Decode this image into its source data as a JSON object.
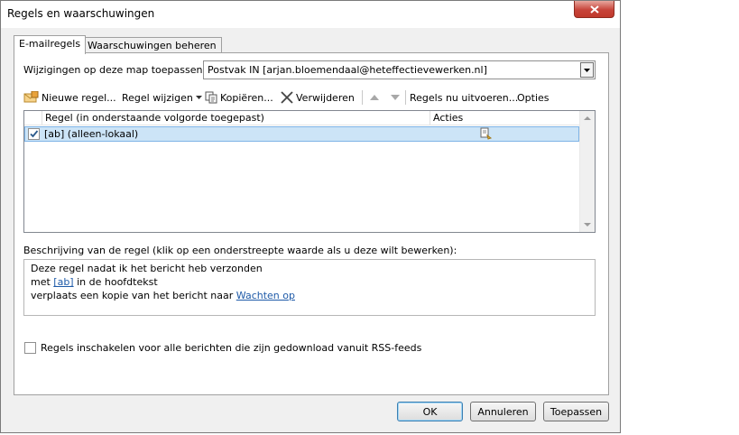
{
  "window": {
    "title": "Regels en waarschuwingen"
  },
  "tabs": [
    {
      "label": "E-mailregels",
      "active": true
    },
    {
      "label": "Waarschuwingen beheren",
      "active": false
    }
  ],
  "folder": {
    "label": "Wijzigingen op deze map toepassen:",
    "value": "Postvak IN [arjan.bloemendaal@heteffectievewerken.nl]"
  },
  "toolbar": {
    "new_rule": "Nieuwe regel...",
    "change_rule": "Regel wijzigen",
    "copy": "Kopiëren...",
    "delete": "Verwijderen",
    "run_rules": "Regels nu uitvoeren...",
    "options": "Opties"
  },
  "rules_list": {
    "columns": [
      "Regel (in onderstaande volgorde toegepast)",
      "Acties"
    ],
    "rows": [
      {
        "name": "[ab]  (alleen-lokaal)",
        "checked": true
      }
    ]
  },
  "description": {
    "label": "Beschrijving van de regel (klik op een onderstreepte waarde als u deze wilt bewerken):",
    "line1": "Deze regel nadat ik het bericht heb verzonden",
    "line2_pre": "met ",
    "line2_link": "[ab]",
    "line2_post": " in de hoofdtekst",
    "line3_pre": "verplaats een kopie van het bericht naar ",
    "line3_link": "Wachten op"
  },
  "rss": {
    "label": "Regels inschakelen voor alle berichten die zijn gedownload vanuit RSS-feeds",
    "checked": false
  },
  "buttons": {
    "ok": "OK",
    "cancel": "Annuleren",
    "apply": "Toepassen"
  },
  "colors": {
    "selection": "#cce4f7",
    "link": "#1e5aa8",
    "close": "#c7443a"
  },
  "icons": [
    "close-icon",
    "new-rule-icon",
    "copy-icon",
    "delete-x-icon",
    "move-up-icon",
    "move-down-icon",
    "checkmark-icon",
    "dropdown-arrow-icon",
    "rule-action-icon"
  ]
}
